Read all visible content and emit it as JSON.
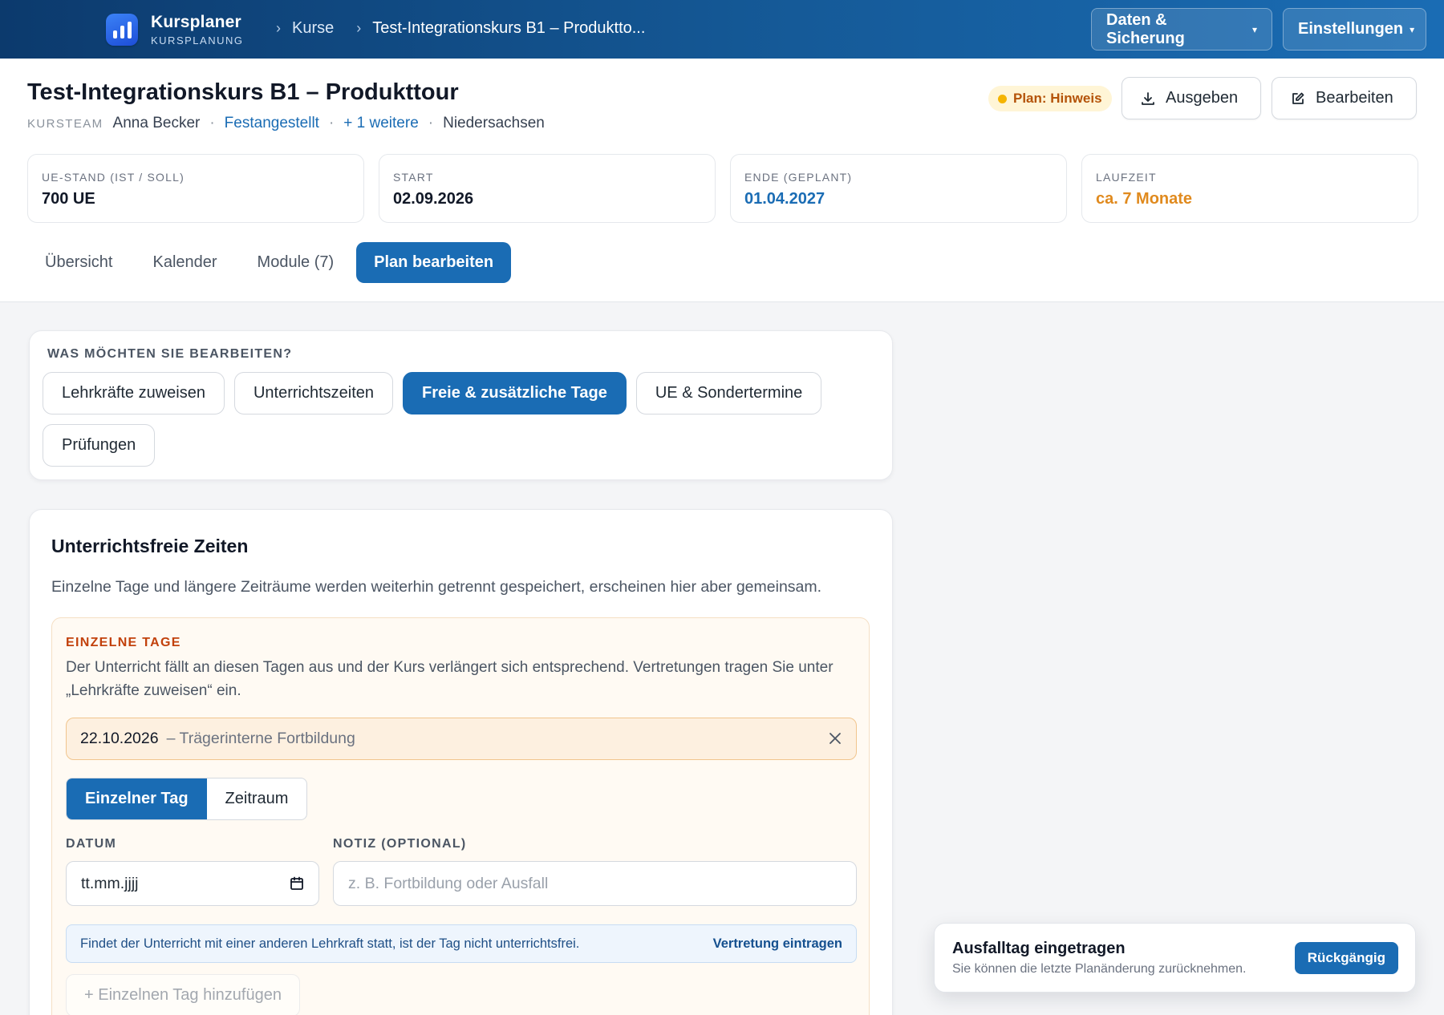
{
  "app": {
    "name": "Kursplaner",
    "subtitle": "KURSPLANUNG"
  },
  "breadcrumb": {
    "items": [
      "Kurse",
      "Test-Integrationskurs B1 – Produktto..."
    ]
  },
  "topbar": {
    "data_button": "Daten & Sicherung",
    "settings_button": "Einstellungen",
    "caret": "▾"
  },
  "course": {
    "title": "Test-Integrationskurs B1 – Produkttour",
    "team_label": "KURSTEAM",
    "teacher": "Anna Becker",
    "employment": "Festangestellt",
    "more": "+ 1 weitere",
    "region": "Niedersachsen",
    "separator": "·"
  },
  "plan_badge": {
    "label": "Plan: Hinweis",
    "color": "#f5b400"
  },
  "actions": {
    "export": "Ausgeben",
    "edit": "Bearbeiten"
  },
  "stats": [
    {
      "label": "UE-STAND (IST / SOLL)",
      "value": "700 UE"
    },
    {
      "label": "START",
      "value": "02.09.2026"
    },
    {
      "label": "ENDE (GEPLANT)",
      "value": "01.04.2027"
    },
    {
      "label": "LAUFZEIT",
      "value": "ca. 7 Monate"
    }
  ],
  "tabs": [
    "Übersicht",
    "Kalender",
    "Module (7)",
    "Plan bearbeiten"
  ],
  "edit_section": {
    "question": "WAS MÖCHTEN SIE BEARBEITEN?",
    "options": [
      "Lehrkräfte zuweisen",
      "Unterrichtszeiten",
      "Freie & zusätzliche Tage",
      "UE & Sondertermine",
      "Prüfungen"
    ],
    "selected": "Freie & zusätzliche Tage"
  },
  "free_times": {
    "title": "Unterrichtsfreie Zeiten",
    "description": "Einzelne Tage und längere Zeiträume werden weiterhin getrennt gespeichert, erscheinen hier aber gemeinsam.",
    "single_days": {
      "label": "EINZELNE TAGE",
      "description": "Der Unterricht fällt an diesen Tagen aus und der Kurs verlängert sich entsprechend. Vertretungen tragen Sie unter „Lehrkräfte zuweisen“ ein.",
      "entries": [
        {
          "date": "22.10.2026",
          "note": "– Trägerinterne Fortbildung"
        }
      ]
    },
    "mode": {
      "options": [
        "Einzelner Tag",
        "Zeitraum"
      ],
      "selected": "Einzelner Tag"
    },
    "date_field": {
      "label": "DATUM",
      "value": "tt.mm.jjjj"
    },
    "note_field": {
      "label": "NOTIZ (OPTIONAL)",
      "placeholder": "z. B. Fortbildung oder Ausfall"
    },
    "info": {
      "text": "Findet der Unterricht mit einer anderen Lehrkraft statt, ist der Tag nicht unterrichtsfrei.",
      "link": "Vertretung eintragen"
    },
    "add_button": "+ Einzelnen Tag hinzufügen"
  },
  "toast": {
    "title": "Ausfalltag eingetragen",
    "text": "Sie können die letzte Planänderung zurücknehmen.",
    "button": "Rückgängig"
  },
  "colors": {
    "primary": "#1a6cb4",
    "warning": "#e08a1e",
    "header_gradient_start": "#0c3a6d"
  }
}
